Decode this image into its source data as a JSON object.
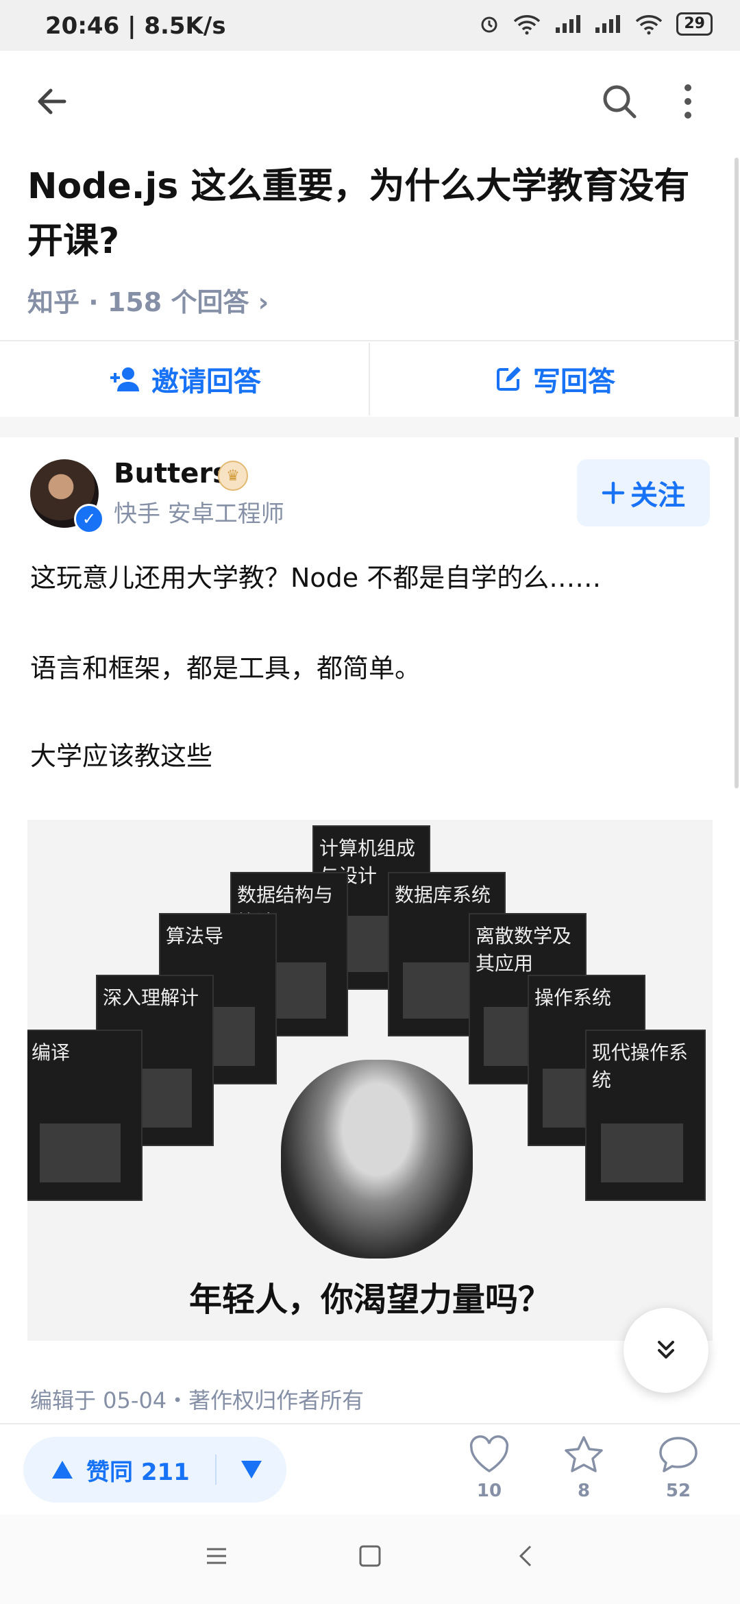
{
  "status_bar": {
    "time": "20:46 | 8.5K/s",
    "battery": "29"
  },
  "top_bar": {
    "back_icon": "arrow-left-icon",
    "search_icon": "search-icon",
    "more_icon": "more-vertical-icon"
  },
  "question": {
    "title": "Node.js 这么重要，为什么大学教育没有开课?",
    "meta": "知乎 · 158 个回答 ›",
    "invite_label": "邀请回答",
    "write_label": "写回答"
  },
  "answer": {
    "author": "Butters",
    "author_desc": "快手 安卓工程师",
    "follow_label": "关注",
    "paragraphs": [
      "这玩意儿还用大学教？Node 不都是自学的么……",
      "语言和框架，都是工具，都简单。",
      "大学应该教这些"
    ],
    "image": {
      "books": [
        "编译",
        "深入理解计",
        "算法导",
        "数据结构与算法",
        "计算机组成与设计",
        "数据库系统",
        "离散数学及其应用",
        "操作系统",
        "现代操作系统"
      ],
      "caption": "年轻人，你渴望力量吗？"
    },
    "edited": "编辑于 05-04・著作权归作者所有"
  },
  "bottom_bar": {
    "vote_label": "赞同 211",
    "likes": "10",
    "favorites": "8",
    "comments": "52"
  },
  "colors": {
    "accent": "#1772f6",
    "muted": "#8590a6",
    "text": "#121212"
  }
}
